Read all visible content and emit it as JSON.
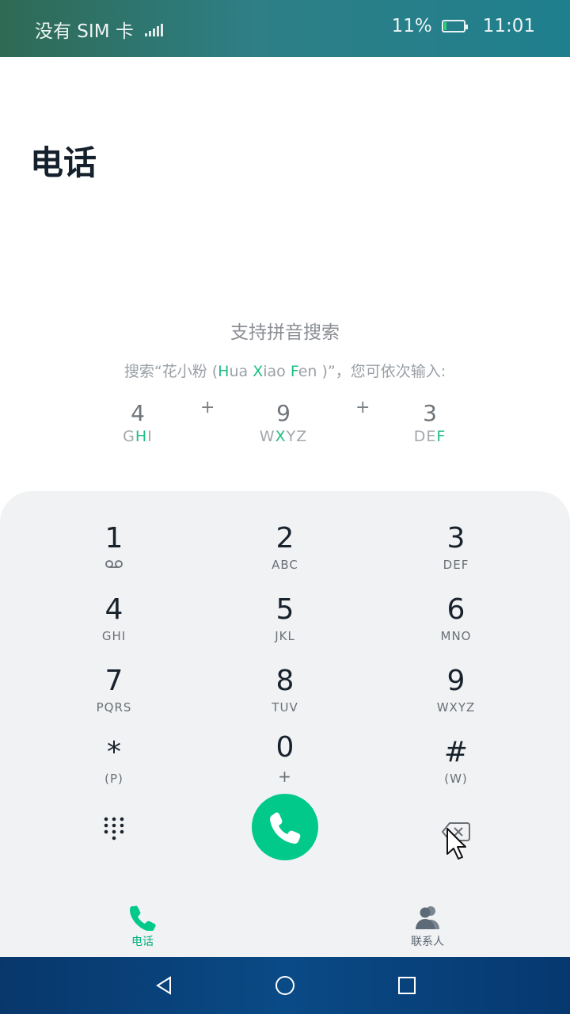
{
  "status_bar": {
    "sim": "没有 SIM 卡",
    "battery": "11%",
    "battery_level": 0.11,
    "time": "11:01"
  },
  "page_title": "电话",
  "hint": {
    "title": "支持拼音搜索",
    "sub_prefix": "搜索“花小粉 (",
    "sub_parts": [
      "H",
      "ua ",
      "X",
      "iao ",
      "F",
      "en"
    ],
    "sub_suffix": " )”，您可依次输入:",
    "keys": [
      {
        "digit": "4",
        "pre": "G",
        "hl": "H",
        "post": "I"
      },
      {
        "digit": "9",
        "pre": "W",
        "hl": "X",
        "post": "YZ"
      },
      {
        "digit": "3",
        "pre": "DE",
        "hl": "F",
        "post": ""
      }
    ],
    "plus": "+"
  },
  "keypad": {
    "keys": [
      {
        "num": "1",
        "sub": ""
      },
      {
        "num": "2",
        "sub": "ABC"
      },
      {
        "num": "3",
        "sub": "DEF"
      },
      {
        "num": "4",
        "sub": "GHI"
      },
      {
        "num": "5",
        "sub": "JKL"
      },
      {
        "num": "6",
        "sub": "MNO"
      },
      {
        "num": "7",
        "sub": "PQRS"
      },
      {
        "num": "8",
        "sub": "TUV"
      },
      {
        "num": "9",
        "sub": "WXYZ"
      },
      {
        "num": "*",
        "sub": "(P)"
      },
      {
        "num": "0",
        "sub": "+"
      },
      {
        "num": "#",
        "sub": "(W)"
      }
    ],
    "voicemail_icon": "voicemail-icon",
    "call_icon": "phone-icon",
    "dialpad_icon": "dialpad-icon",
    "backspace_icon": "backspace-icon"
  },
  "tabs": {
    "phone": "电话",
    "contacts": "联系人"
  },
  "colors": {
    "accent": "#00c98a",
    "keypad_bg": "#f1f2f4",
    "text_dark": "#18222c"
  }
}
